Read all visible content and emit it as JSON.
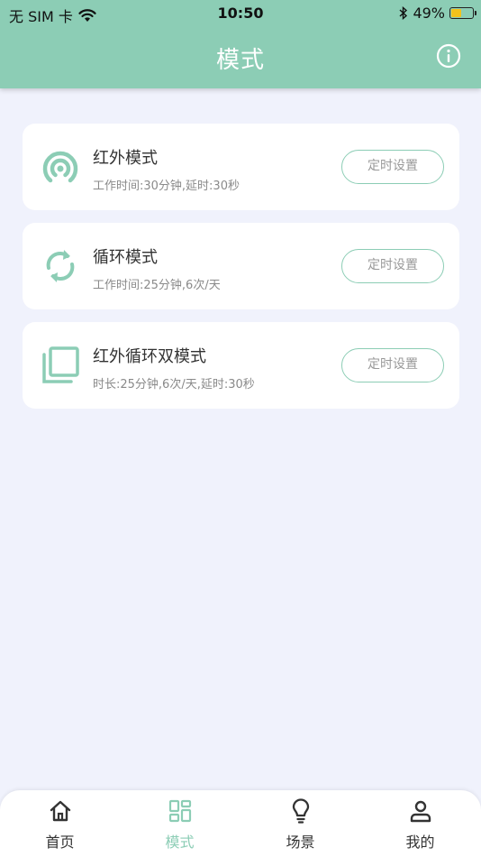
{
  "status_bar": {
    "carrier": "无 SIM 卡",
    "time": "10:50",
    "battery": "49%",
    "battery_level": 0.49,
    "icons": [
      "wifi-icon",
      "bluetooth-icon",
      "battery-icon"
    ]
  },
  "header": {
    "title": "模式",
    "info_icon": "info-icon"
  },
  "colors": {
    "accent": "#8ccdb5",
    "background": "#f0f2fc",
    "battery": "#f2c21b"
  },
  "modes": [
    {
      "title": "红外模式",
      "subtitle": "工作时间:30分钟,延时:30秒",
      "button": "定时设置",
      "icon": "infrared-signal-icon"
    },
    {
      "title": "循环模式",
      "subtitle": "工作时间:25分钟,6次/天",
      "button": "定时设置",
      "icon": "cycle-icon"
    },
    {
      "title": "红外循环双模式",
      "subtitle": "时长:25分钟,6次/天,延时:30秒",
      "button": "定时设置",
      "icon": "dual-mode-icon"
    }
  ],
  "tabs": [
    {
      "label": "首页",
      "icon": "home-icon",
      "active": false
    },
    {
      "label": "模式",
      "icon": "grid-icon",
      "active": true
    },
    {
      "label": "场景",
      "icon": "bulb-icon",
      "active": false
    },
    {
      "label": "我的",
      "icon": "user-icon",
      "active": false
    }
  ]
}
